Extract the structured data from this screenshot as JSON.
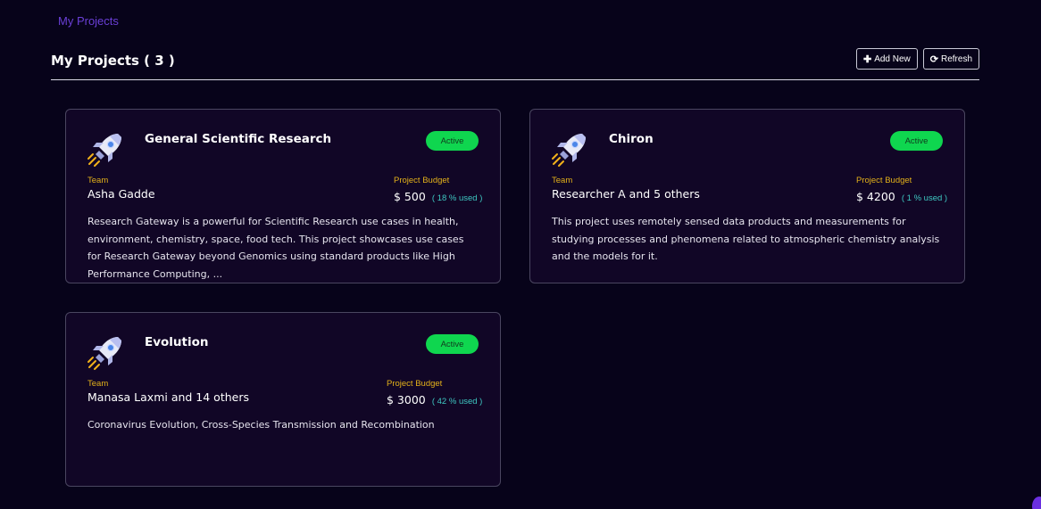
{
  "breadcrumb": {
    "label": "My Projects"
  },
  "header": {
    "title": "My Projects ( 3 )",
    "add_new_label": "Add New",
    "refresh_label": "Refresh",
    "add_icon": "plus-icon",
    "refresh_icon": "refresh-icon"
  },
  "colors": {
    "background": "#07031a",
    "card_background": "#110626",
    "accent": "#6a3fd6",
    "status_active": "#0fd64f",
    "label_gold": "#e3b11a",
    "used_teal": "#3ec8c2"
  },
  "projects": [
    {
      "title": "General Scientific Research",
      "status": "Active",
      "team_label": "Team",
      "team": "Asha Gadde",
      "budget_label": "Project Budget",
      "budget": "$ 500",
      "used": "( 18 % used )",
      "description": "Research Gateway is a powerful for Scientific Research use cases in health, environment, chemistry, space, food tech. This project showcases use cases for Research Gateway beyond Genomics using standard products like High Performance Computing, ...",
      "icon": "rocket-icon"
    },
    {
      "title": "Chiron",
      "status": "Active",
      "team_label": "Team",
      "team": "Researcher A and 5 others",
      "budget_label": "Project Budget",
      "budget": "$ 4200",
      "used": "( 1 % used )",
      "description": "This project uses remotely sensed data products and measurements for studying processes and phenomena related to atmospheric chemistry analysis and the models for it.",
      "icon": "rocket-icon"
    },
    {
      "title": "Evolution",
      "status": "Active",
      "team_label": "Team",
      "team": "Manasa Laxmi and 14 others",
      "budget_label": "Project Budget",
      "budget": "$ 3000",
      "used": "( 42 % used )",
      "description": "Coronavirus Evolution, Cross-Species Transmission and Recombination",
      "icon": "rocket-icon"
    }
  ]
}
